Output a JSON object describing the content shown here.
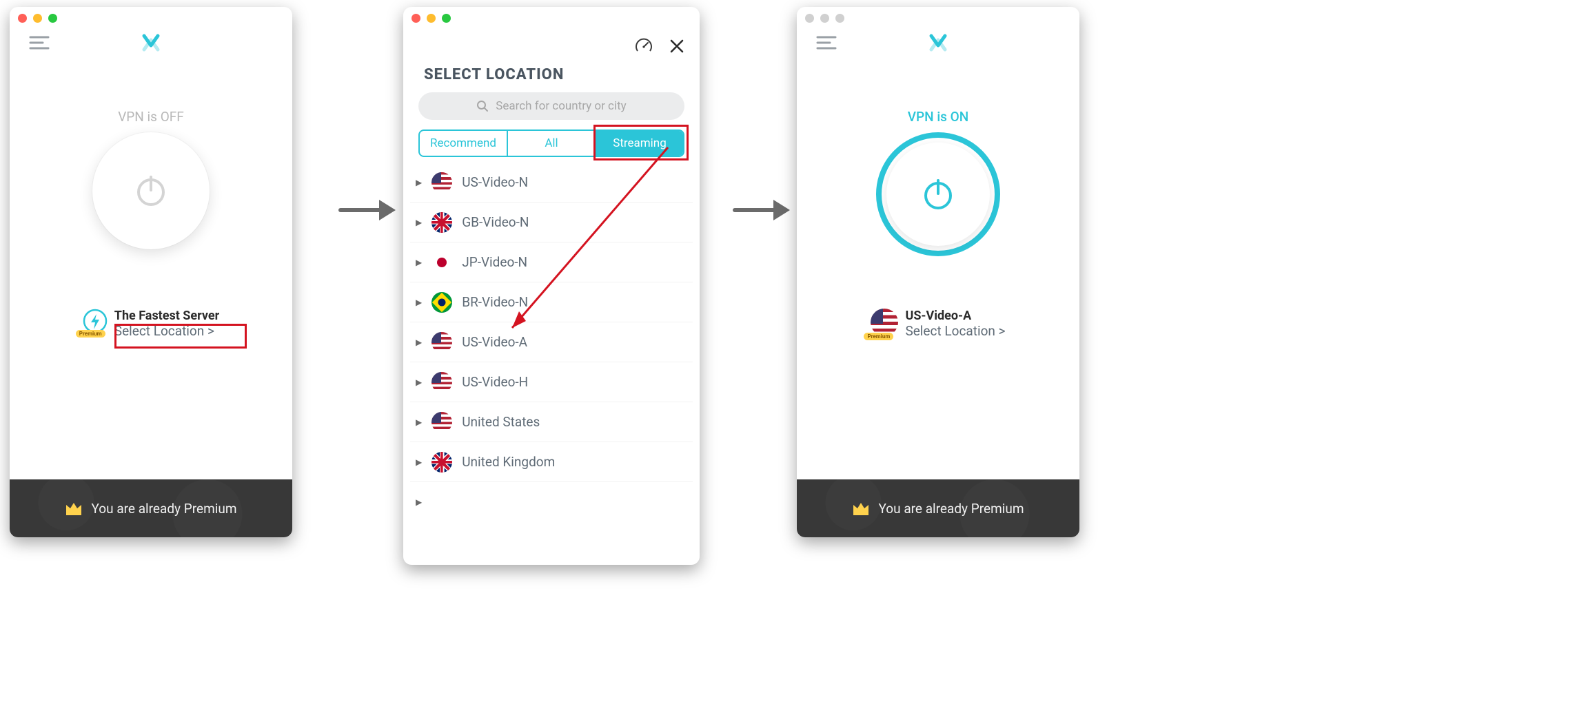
{
  "panel1": {
    "status": "VPN is OFF",
    "server_title": "The Fastest Server",
    "select_location": "Select Location >",
    "premium_chip": "Premium",
    "banner": "You are already Premium"
  },
  "panel2": {
    "title": "SELECT LOCATION",
    "search_placeholder": "Search for country or city",
    "tabs": {
      "recommend": "Recommend",
      "all": "All",
      "streaming": "Streaming"
    },
    "items": [
      {
        "name": "US-Video-N",
        "flag": "us"
      },
      {
        "name": "GB-Video-N",
        "flag": "gb"
      },
      {
        "name": "JP-Video-N",
        "flag": "jp"
      },
      {
        "name": "BR-Video-N",
        "flag": "br"
      },
      {
        "name": "US-Video-A",
        "flag": "us"
      },
      {
        "name": "US-Video-H",
        "flag": "us"
      },
      {
        "name": "United States",
        "flag": "us"
      },
      {
        "name": "United Kingdom",
        "flag": "gb"
      }
    ]
  },
  "panel3": {
    "status": "VPN is ON",
    "server_title": "US-Video-A",
    "select_location": "Select Location >",
    "premium_chip": "Premium",
    "banner": "You are already Premium"
  }
}
